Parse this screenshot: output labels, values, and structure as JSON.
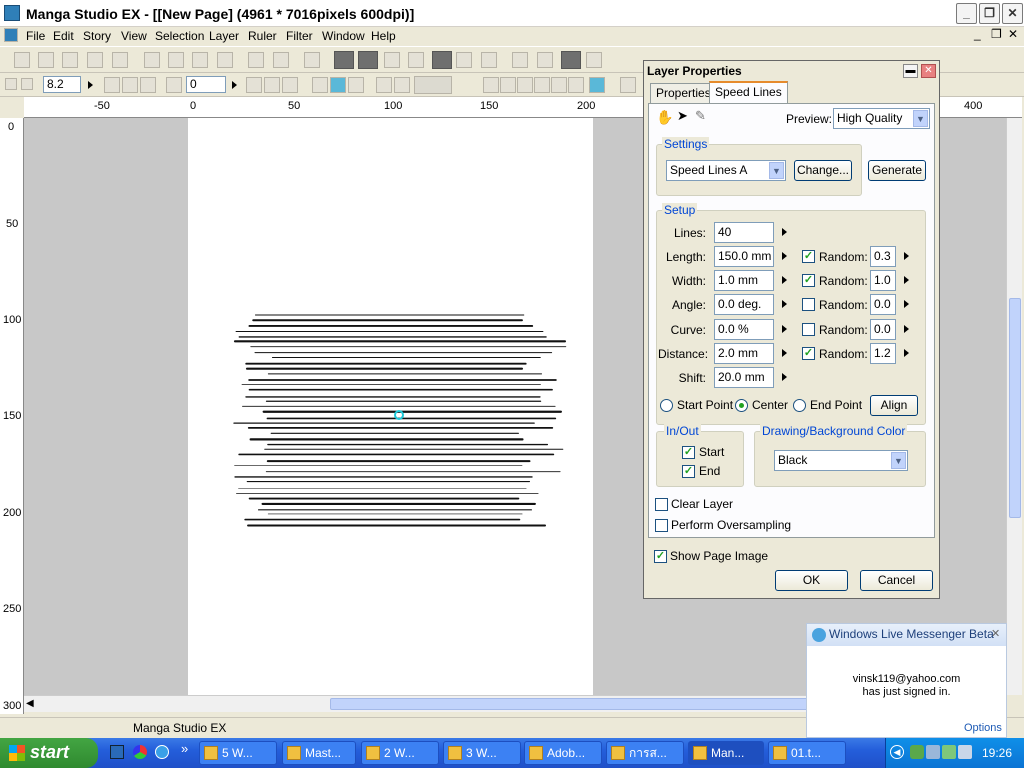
{
  "window": {
    "title": "Manga Studio EX - [[New Page] (4961 * 7016pixels 600dpi)]",
    "minimize": "_",
    "restore": "❐",
    "close": "✕"
  },
  "menu": [
    "File",
    "Edit",
    "Story",
    "View",
    "Selection",
    "Layer",
    "Ruler",
    "Filter",
    "Window",
    "Help"
  ],
  "toolbar2": {
    "zoom_value": "8.2",
    "rotation_value": "0"
  },
  "ruler": {
    "h_labels": [
      "-50",
      "0",
      "50",
      "100",
      "150",
      "200",
      "400"
    ],
    "v_labels": [
      "0",
      "50",
      "100",
      "150",
      "200",
      "250",
      "300"
    ]
  },
  "status": {
    "text": "Manga Studio EX"
  },
  "dialog": {
    "title": "Layer Properties",
    "tabs": [
      "Properties",
      "Speed Lines"
    ],
    "preview_label": "Preview:",
    "preview_value": "High Quality",
    "settings_group": "Settings",
    "settings_value": "Speed Lines A",
    "change_button": "Change...",
    "generate_button": "Generate",
    "setup_group": "Setup",
    "rows": [
      {
        "label": "Lines:",
        "value": "40"
      },
      {
        "label": "Length:",
        "value": "150.0 mm",
        "random": "Random:",
        "random_checked": true,
        "random_value": "0.3"
      },
      {
        "label": "Width:",
        "value": "1.0 mm",
        "random": "Random:",
        "random_checked": true,
        "random_value": "1.0"
      },
      {
        "label": "Angle:",
        "value": "0.0 deg.",
        "random": "Random:",
        "random_checked": false,
        "random_value": "0.0"
      },
      {
        "label": "Curve:",
        "value": "0.0 %",
        "random": "Random:",
        "random_checked": false,
        "random_value": "0.0"
      },
      {
        "label": "Distance:",
        "value": "2.0 mm",
        "random": "Random:",
        "random_checked": true,
        "random_value": "1.2"
      },
      {
        "label": "Shift:",
        "value": "20.0 mm"
      }
    ],
    "radio": {
      "start": "Start Point",
      "center": "Center",
      "end": "End Point",
      "selected": "center"
    },
    "align_button": "Align",
    "inout_group": "In/Out",
    "inout_start": "Start",
    "inout_end": "End",
    "color_group": "Drawing/Background Color",
    "color_value": "Black",
    "clear_layer": "Clear Layer",
    "oversampling": "Perform Oversampling",
    "show_page_image": "Show Page Image",
    "ok": "OK",
    "cancel": "Cancel",
    "check_mark": "✓"
  },
  "notification": {
    "title": "Windows Live Messenger Beta",
    "line1": "vinsk119@yahoo.com",
    "line2": "has just signed in.",
    "options": "Options",
    "close": "✕"
  },
  "taskbar": {
    "start": "start",
    "tasks": [
      {
        "label": "5 W...",
        "active": false
      },
      {
        "label": "Mast...",
        "active": false
      },
      {
        "label": "2 W...",
        "active": false
      },
      {
        "label": "3 W...",
        "active": false
      },
      {
        "label": "Adob...",
        "active": false
      },
      {
        "label": "การส...",
        "active": false
      },
      {
        "label": "Man...",
        "active": true
      },
      {
        "label": "01.t...",
        "active": false
      }
    ],
    "clock": "19:26"
  },
  "colors": {
    "accent": "#245edb",
    "title_active": "#e68b2c",
    "check": "#21a121",
    "canvas": "#c8c8c8"
  }
}
